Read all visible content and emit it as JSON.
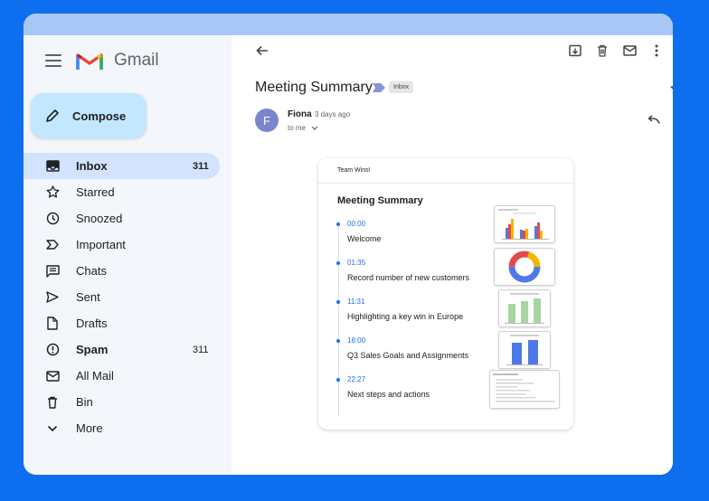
{
  "app": {
    "name": "Gmail"
  },
  "compose": {
    "label": "Compose"
  },
  "nav": [
    {
      "label": "Inbox",
      "count": "311",
      "icon": "inbox-icon",
      "bold": true,
      "active": true
    },
    {
      "label": "Starred",
      "count": "",
      "icon": "star-icon"
    },
    {
      "label": "Snoozed",
      "count": "",
      "icon": "clock-icon"
    },
    {
      "label": "Important",
      "count": "",
      "icon": "important-icon"
    },
    {
      "label": "Chats",
      "count": "",
      "icon": "chat-icon"
    },
    {
      "label": "Sent",
      "count": "",
      "icon": "send-icon"
    },
    {
      "label": "Drafts",
      "count": "",
      "icon": "draft-icon"
    },
    {
      "label": "Spam",
      "count": "311",
      "icon": "spam-icon",
      "bold": true
    },
    {
      "label": "All Mail",
      "count": "",
      "icon": "mail-icon"
    },
    {
      "label": "Bin",
      "count": "",
      "icon": "trash-icon"
    },
    {
      "label": "More",
      "count": "",
      "icon": "chevron-down-icon"
    }
  ],
  "email": {
    "subject": "Meeting Summary",
    "label_chip": "Inbox",
    "sender_initial": "F",
    "sender": "Fiona",
    "time": "3 days ago",
    "to": "to me"
  },
  "card": {
    "header": "Team Wins!",
    "title": "Meeting Summary",
    "items": [
      {
        "time": "00:00",
        "title": "Welcome"
      },
      {
        "time": "01:35",
        "title": "Record number of new customers"
      },
      {
        "time": "11:31",
        "title": "Highlighting a key win in Europe"
      },
      {
        "time": "18:00",
        "title": "Q3 Sales Goals and Assignments"
      },
      {
        "time": "22:27",
        "title": "Next steps and actions"
      }
    ]
  },
  "colors": {
    "background": "#0d6ff0",
    "active_nav": "#d3e3fd",
    "compose": "#c2e7ff",
    "accent": "#1a73e8"
  }
}
